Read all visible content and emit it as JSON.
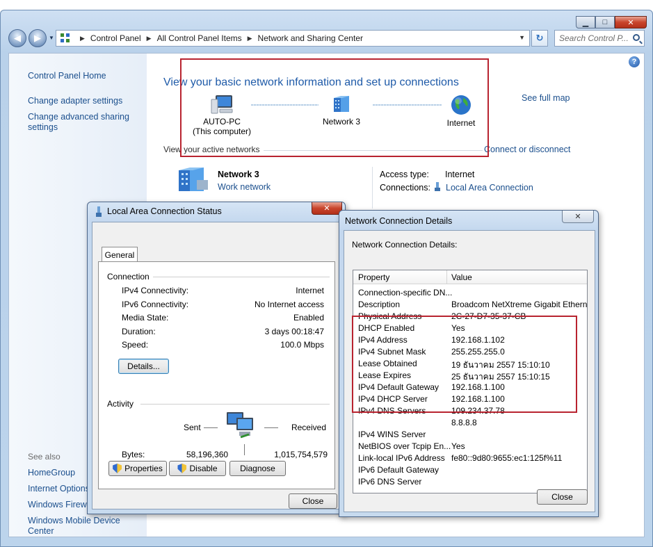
{
  "window": {
    "breadcrumb": [
      "Control Panel",
      "All Control Panel Items",
      "Network and Sharing Center"
    ],
    "search_placeholder": "Search Control P...",
    "minimize": "▁",
    "maximize": "□",
    "close": "✕",
    "back": "◀",
    "forward": "▶",
    "refresh": "↻",
    "help": "?"
  },
  "sidebar": {
    "control_panel_home": "Control Panel Home",
    "change_adapter": "Change adapter settings",
    "change_advanced_1": "Change advanced sharing",
    "change_advanced_2": "settings",
    "see_also": "See also",
    "see_also_items": [
      "HomeGroup",
      "Internet Options",
      "Windows Firewall",
      "Windows Mobile Device Center"
    ]
  },
  "main": {
    "title": "View your basic network information and set up connections",
    "see_full_map": "See full map",
    "nodes": [
      {
        "name": "AUTO-PC",
        "sub": "(This computer)",
        "icon": "computer-icon"
      },
      {
        "name": "Network  3",
        "sub": "",
        "icon": "network-icon"
      },
      {
        "name": "Internet",
        "sub": "",
        "icon": "globe-icon"
      }
    ],
    "active_networks_label": "View your active networks",
    "connect_or_disconnect": "Connect or disconnect",
    "active_network": {
      "name": "Network  3",
      "type": "Work network",
      "access_type_label": "Access type:",
      "access_type_value": "Internet",
      "connections_label": "Connections:",
      "connections_value": "Local Area Connection"
    }
  },
  "status_dialog": {
    "title": "Local Area Connection Status",
    "close": "✕",
    "tab": "General",
    "connection_group": "Connection",
    "rows": [
      {
        "label": "IPv4 Connectivity:",
        "value": "Internet"
      },
      {
        "label": "IPv6 Connectivity:",
        "value": "No Internet access"
      },
      {
        "label": "Media State:",
        "value": "Enabled"
      },
      {
        "label": "Duration:",
        "value": "3 days 00:18:47"
      },
      {
        "label": "Speed:",
        "value": "100.0 Mbps"
      }
    ],
    "details_button": "Details...",
    "activity_group": "Activity",
    "sent_label": "Sent",
    "received_label": "Received",
    "bytes_label": "Bytes:",
    "bytes_sent": "58,196,360",
    "bytes_received": "1,015,754,579",
    "properties_button": "Properties",
    "disable_button": "Disable",
    "diagnose_button": "Diagnose",
    "close_button": "Close"
  },
  "details_dialog": {
    "title": "Network Connection Details",
    "close": "✕",
    "label": "Network Connection Details:",
    "col_property": "Property",
    "col_value": "Value",
    "rows": [
      {
        "property": "Connection-specific DN...",
        "value": ""
      },
      {
        "property": "Description",
        "value": "Broadcom NetXtreme Gigabit Ethernet"
      },
      {
        "property": "Physical Address",
        "value": "2C-27-D7-35-37-CB"
      },
      {
        "property": "DHCP Enabled",
        "value": "Yes"
      },
      {
        "property": "IPv4 Address",
        "value": "192.168.1.102"
      },
      {
        "property": "IPv4 Subnet Mask",
        "value": "255.255.255.0"
      },
      {
        "property": "Lease Obtained",
        "value": "19 ธันวาคม 2557 15:10:10"
      },
      {
        "property": "Lease Expires",
        "value": "25 ธันวาคม 2557 15:10:15"
      },
      {
        "property": "IPv4 Default Gateway",
        "value": "192.168.1.100"
      },
      {
        "property": "IPv4 DHCP Server",
        "value": "192.168.1.100"
      },
      {
        "property": "IPv4 DNS Servers",
        "value": "109.234.37.78"
      },
      {
        "property": "",
        "value": "8.8.8.8"
      },
      {
        "property": "IPv4 WINS Server",
        "value": ""
      },
      {
        "property": "NetBIOS over Tcpip En...",
        "value": "Yes"
      },
      {
        "property": "Link-local IPv6 Address",
        "value": "fe80::9d80:9655:ec1:125f%11"
      },
      {
        "property": "IPv6 Default Gateway",
        "value": ""
      },
      {
        "property": "IPv6 DNS Server",
        "value": ""
      }
    ],
    "close_button": "Close"
  }
}
